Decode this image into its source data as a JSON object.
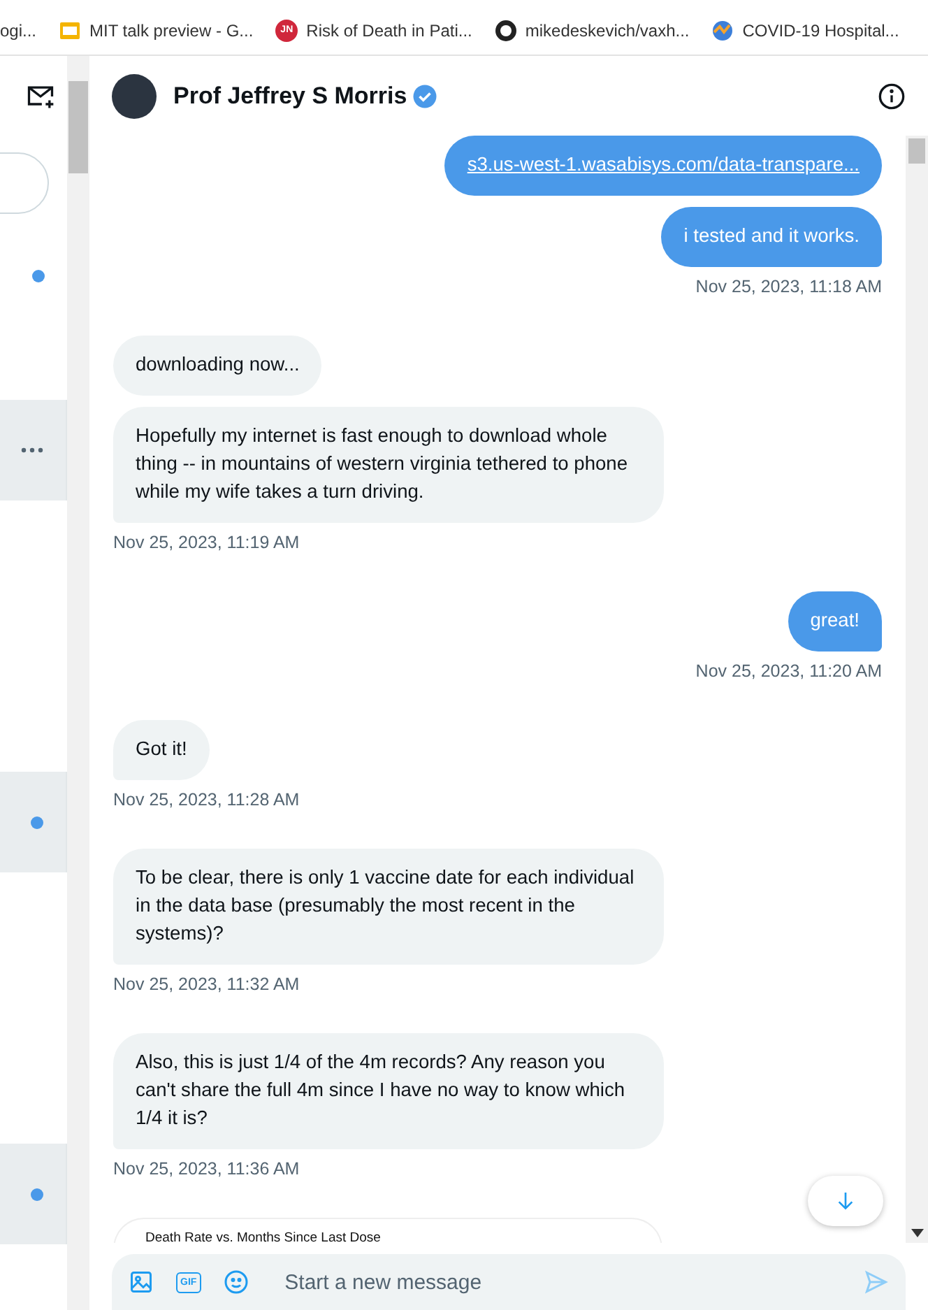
{
  "bookmarks": [
    {
      "label": "ogi..."
    },
    {
      "label": "MIT talk preview - G..."
    },
    {
      "label": "Risk of Death in Pati...",
      "icon_text": "JN"
    },
    {
      "label": "mikedeskevich/vaxh..."
    },
    {
      "label": "COVID-19 Hospital..."
    }
  ],
  "sidebar": {
    "rows": [
      {
        "highlighted": false,
        "unread": true,
        "menu": false
      },
      {
        "highlighted": true,
        "unread": false,
        "menu": true
      },
      {
        "highlighted": true,
        "unread": true,
        "menu": false
      },
      {
        "highlighted": true,
        "unread": true,
        "menu": false
      }
    ]
  },
  "conversation": {
    "name": "Prof Jeffrey S Morris",
    "verified": true
  },
  "messages": [
    {
      "kind": "sent",
      "bubbles": [
        {
          "kind": "link",
          "text": "s3.us-west-1.wasabisys.com/data-transpare..."
        },
        {
          "kind": "text",
          "text": "i tested and it works."
        }
      ],
      "timestamp": "Nov 25, 2023, 11:18 AM"
    },
    {
      "kind": "received",
      "bubbles": [
        {
          "kind": "text",
          "text": "downloading now..."
        },
        {
          "kind": "text",
          "text": "Hopefully my internet is fast enough to download whole thing -- in mountains of western virginia tethered to phone while my wife takes a turn driving."
        }
      ],
      "timestamp": "Nov 25, 2023, 11:19 AM"
    },
    {
      "kind": "sent",
      "bubbles": [
        {
          "kind": "text",
          "text": "great!"
        }
      ],
      "timestamp": "Nov 25, 2023, 11:20 AM"
    },
    {
      "kind": "received",
      "bubbles": [
        {
          "kind": "text",
          "text": "Got it!"
        }
      ],
      "timestamp": "Nov 25, 2023, 11:28 AM"
    },
    {
      "kind": "received",
      "bubbles": [
        {
          "kind": "text",
          "text": "To be clear, there is only 1 vaccine date for each individual in the data base (presumably the most recent in the systems)?"
        }
      ],
      "timestamp": "Nov 25, 2023, 11:32 AM"
    },
    {
      "kind": "received",
      "bubbles": [
        {
          "kind": "text",
          "text": "Also, this is just 1/4 of the 4m records?  Any reason you can't share the full 4m since I have no way to know which 1/4 it is?"
        }
      ],
      "timestamp": "Nov 25, 2023, 11:36 AM"
    },
    {
      "kind": "received",
      "bubbles": [
        {
          "kind": "chart",
          "text": "Death Rate vs. Months Since Last Dose"
        }
      ]
    }
  ],
  "composer": {
    "placeholder": "Start a new message",
    "gif_label": "GIF"
  }
}
